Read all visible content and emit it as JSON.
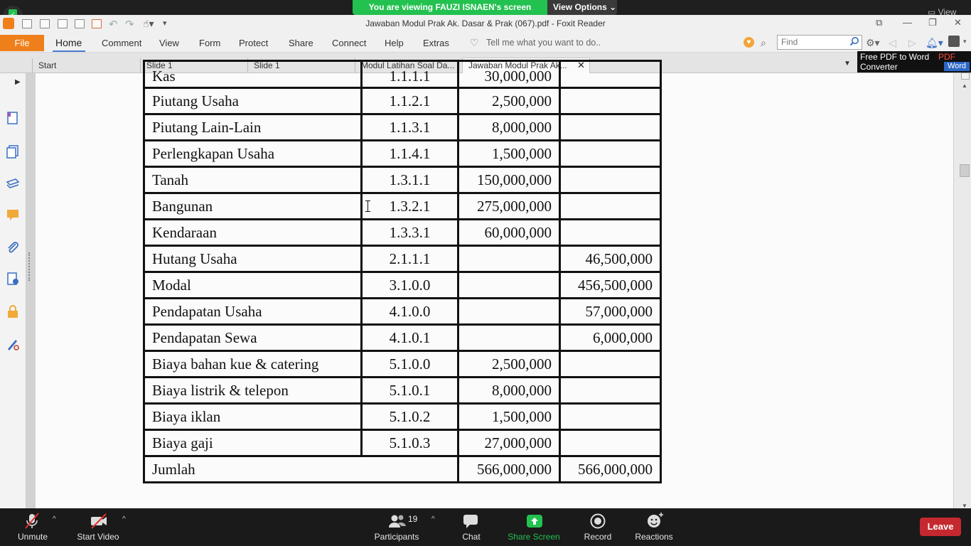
{
  "zoom_top": {
    "sharing_text": "You are viewing FAUZI ISNAEN's screen",
    "view_options": "View Options",
    "view_button": "View"
  },
  "window": {
    "title": "Jawaban Modul Prak Ak. Dasar & Prak (067).pdf - Foxit Reader"
  },
  "ribbon": {
    "file": "File",
    "menus": [
      "Home",
      "Comment",
      "View",
      "Form",
      "Protect",
      "Share",
      "Connect",
      "Help",
      "Extras"
    ],
    "tell_me_placeholder": "Tell me what you want to do..",
    "find_placeholder": "Find"
  },
  "tabs": [
    "Start",
    "Slide 1",
    "Slide 1",
    "Modul Latihan Soal Da...",
    "Jawaban Modul Prak Ak..."
  ],
  "promo": {
    "line1": "Free PDF to Word",
    "line2": "Converter",
    "pdf": "PDF",
    "word": "Word"
  },
  "ledger": {
    "rows": [
      {
        "name": "Kas",
        "code": "1.1.1.1",
        "debit": "30,000,000",
        "credit": ""
      },
      {
        "name": "Piutang Usaha",
        "code": "1.1.2.1",
        "debit": "2,500,000",
        "credit": ""
      },
      {
        "name": "Piutang Lain-Lain",
        "code": "1.1.3.1",
        "debit": "8,000,000",
        "credit": ""
      },
      {
        "name": "Perlengkapan Usaha",
        "code": "1.1.4.1",
        "debit": "1,500,000",
        "credit": ""
      },
      {
        "name": "Tanah",
        "code": "1.3.1.1",
        "debit": "150,000,000",
        "credit": ""
      },
      {
        "name": "Bangunan",
        "code": "1.3.2.1",
        "debit": "275,000,000",
        "credit": ""
      },
      {
        "name": "Kendaraan",
        "code": "1.3.3.1",
        "debit": "60,000,000",
        "credit": ""
      },
      {
        "name": "Hutang Usaha",
        "code": "2.1.1.1",
        "debit": "",
        "credit": "46,500,000"
      },
      {
        "name": "Modal",
        "code": "3.1.0.0",
        "debit": "",
        "credit": "456,500,000"
      },
      {
        "name": "Pendapatan Usaha",
        "code": "4.1.0.0",
        "debit": "",
        "credit": "57,000,000"
      },
      {
        "name": "Pendapatan Sewa",
        "code": "4.1.0.1",
        "debit": "",
        "credit": "6,000,000"
      },
      {
        "name": "Biaya bahan kue & catering",
        "code": "5.1.0.0",
        "debit": "2,500,000",
        "credit": ""
      },
      {
        "name": "Biaya listrik & telepon",
        "code": "5.1.0.1",
        "debit": "8,000,000",
        "credit": ""
      },
      {
        "name": "Biaya iklan",
        "code": "5.1.0.2",
        "debit": "1,500,000",
        "credit": ""
      },
      {
        "name": "Biaya gaji",
        "code": "5.1.0.3",
        "debit": "27,000,000",
        "credit": ""
      }
    ],
    "total": {
      "label": "Jumlah",
      "debit": "566,000,000",
      "credit": "566,000,000"
    }
  },
  "zoom_bottom": {
    "unmute": "Unmute",
    "start_video": "Start Video",
    "participants": "Participants",
    "participant_count": "19",
    "chat": "Chat",
    "share_screen": "Share Screen",
    "record": "Record",
    "reactions": "Reactions",
    "leave": "Leave"
  },
  "colors": {
    "zoom_green": "#23c14f",
    "foxit_orange": "#ef7f1a",
    "leave_red": "#c6282f"
  }
}
